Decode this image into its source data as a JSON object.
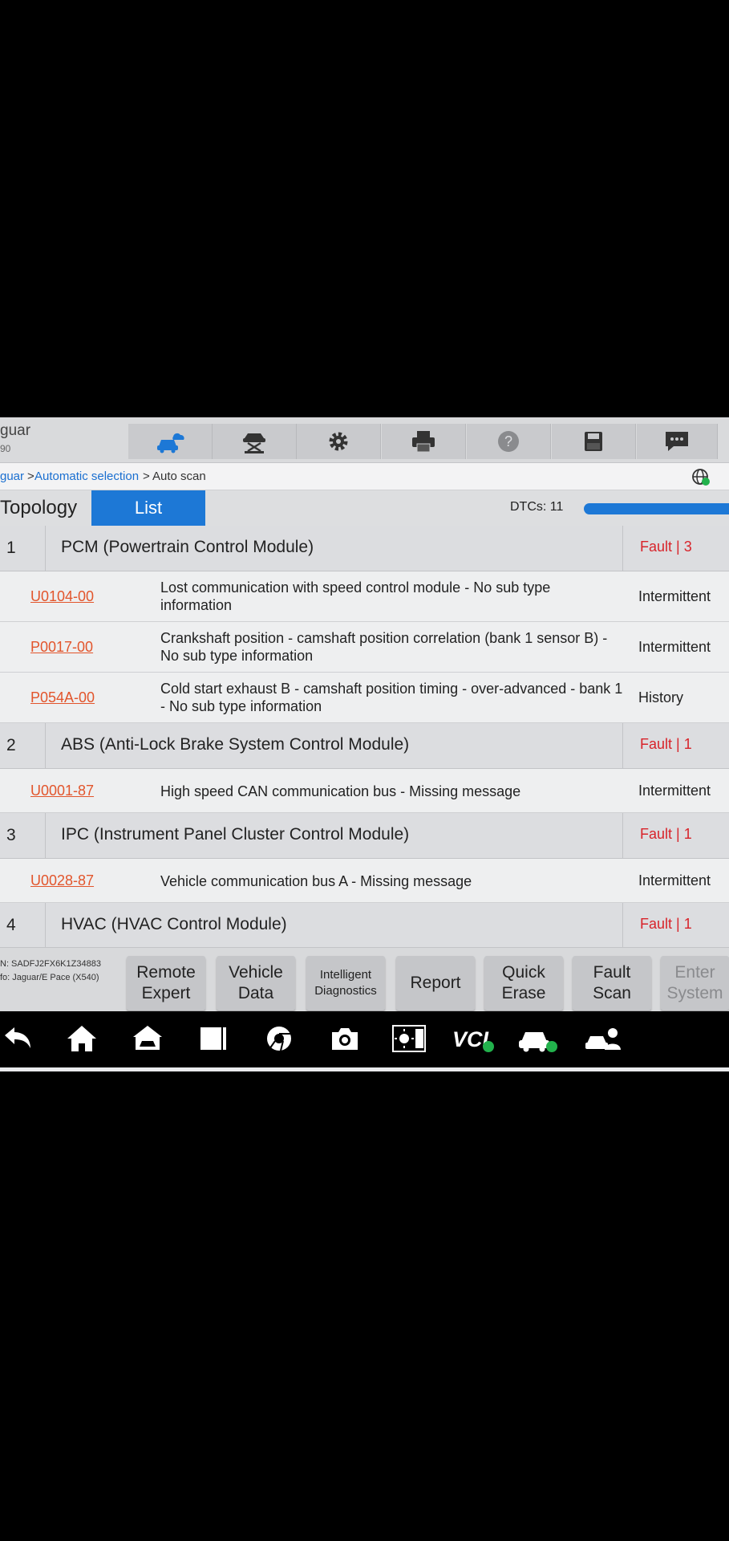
{
  "header": {
    "app_title": "guar",
    "app_subtitle": "90",
    "toolbar_icons": [
      "car-cloud-icon",
      "lift-icon",
      "gear-icon",
      "printer-icon",
      "help-icon",
      "save-icon",
      "message-icon"
    ]
  },
  "breadcrumb": {
    "items": [
      "guar",
      "Automatic selection",
      "Auto scan"
    ],
    "separator": ">"
  },
  "tabs": {
    "topology": "Topology",
    "list": "List",
    "dtc_count": "DTCs: 11",
    "scan_progress": 1.0
  },
  "modules": [
    {
      "num": "1",
      "name": "PCM (Powertrain Control Module)",
      "fault": "Fault | 3",
      "dtcs": [
        {
          "code": "U0104-00",
          "desc": "Lost communication with speed control module - No sub type information",
          "status": "Intermittent"
        },
        {
          "code": "P0017-00",
          "desc": "Crankshaft position - camshaft position correlation (bank 1 sensor B) - No sub type information",
          "status": "Intermittent"
        },
        {
          "code": "P054A-00",
          "desc": "Cold start exhaust B - camshaft position timing - over-advanced - bank 1 - No sub type information",
          "status": "History"
        }
      ]
    },
    {
      "num": "2",
      "name": "ABS (Anti-Lock Brake System Control Module)",
      "fault": "Fault | 1",
      "dtcs": [
        {
          "code": "U0001-87",
          "desc": "High speed CAN communication bus - Missing message",
          "status": "Intermittent"
        }
      ]
    },
    {
      "num": "3",
      "name": "IPC (Instrument Panel Cluster Control Module)",
      "fault": "Fault | 1",
      "dtcs": [
        {
          "code": "U0028-87",
          "desc": "Vehicle communication bus A - Missing message",
          "status": "Intermittent"
        }
      ]
    },
    {
      "num": "4",
      "name": "HVAC (HVAC Control Module)",
      "fault": "Fault | 1",
      "dtcs": []
    }
  ],
  "footer": {
    "vin": "N: SADFJ2FX6K1Z34883",
    "vehicle_info": "fo: Jaguar/E Pace (X540)",
    "buttons": [
      {
        "label": "Remote\nExpert",
        "name": "remote-expert-button"
      },
      {
        "label": "Vehicle\nData",
        "name": "vehicle-data-button"
      },
      {
        "label": "Intelligent\nDiagnostics",
        "name": "intelligent-diagnostics-button",
        "small": true
      },
      {
        "label": "Report",
        "name": "report-button"
      },
      {
        "label": "Quick\nErase",
        "name": "quick-erase-button"
      },
      {
        "label": "Fault\nScan",
        "name": "fault-scan-button"
      },
      {
        "label": "Enter\nSystem",
        "name": "enter-system-button",
        "disabled": true
      }
    ]
  },
  "navbar": {
    "icons": [
      "back-icon",
      "home-icon",
      "car-home-icon",
      "recent-apps-icon",
      "chrome-icon",
      "camera-icon",
      "brightness-icon",
      "vci-icon",
      "vehicle-status-icon",
      "user-car-icon"
    ],
    "vci_label": "VCI"
  },
  "colors": {
    "accent": "#1d78d6",
    "fault": "#d8232a",
    "dtc_code": "#e2552c",
    "status_ok": "#22b14c"
  }
}
